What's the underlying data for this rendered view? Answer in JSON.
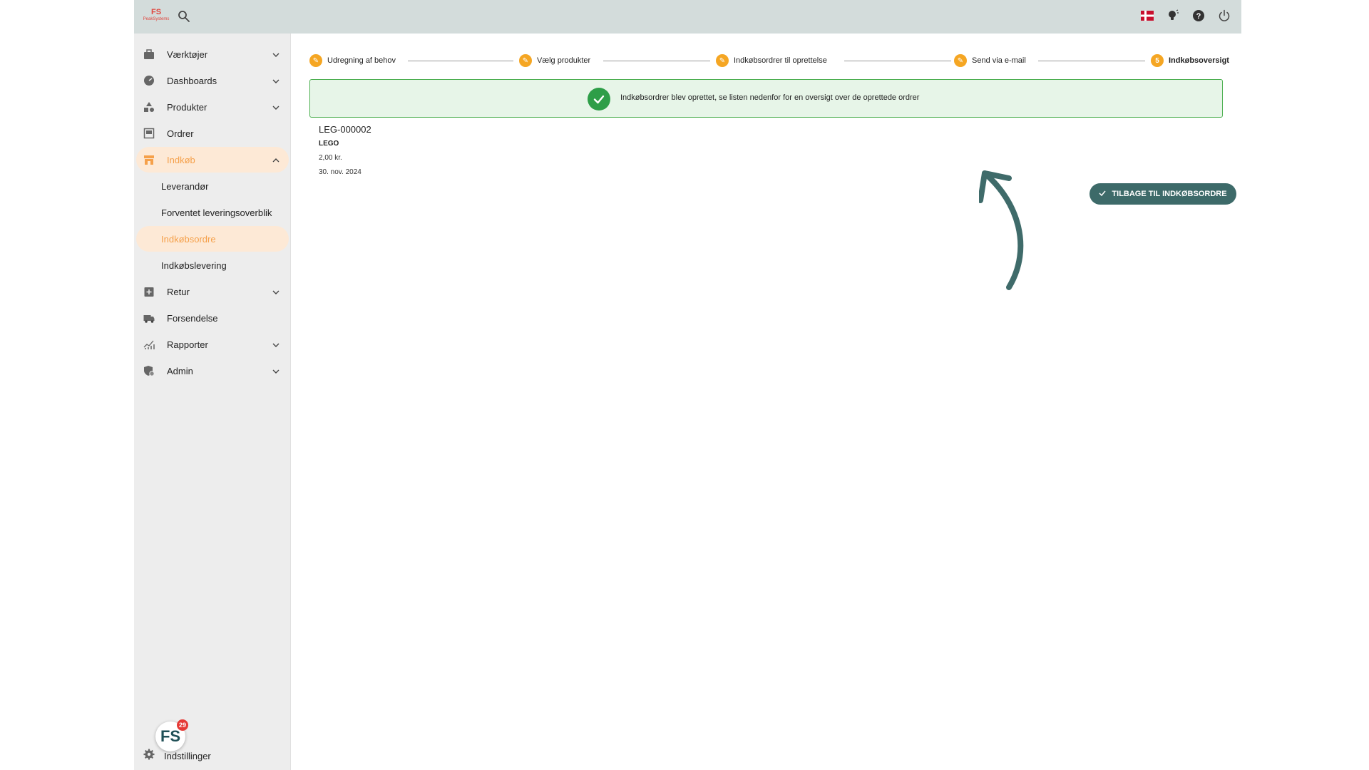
{
  "topbar": {
    "logo_mark": "FS",
    "logo_name": "PeakSystems",
    "icons": [
      "search-icon",
      "danish-flag-icon",
      "lightbulb-icon",
      "help-icon",
      "power-icon"
    ]
  },
  "sidebar": {
    "items": [
      {
        "label": "Værktøjer",
        "icon": "toolbox-icon"
      },
      {
        "label": "Dashboards",
        "icon": "gauge-icon"
      },
      {
        "label": "Produkter",
        "icon": "shapes-icon"
      },
      {
        "label": "Ordrer",
        "icon": "inbox-icon"
      },
      {
        "label": "Indkøb",
        "icon": "store-icon"
      },
      {
        "label": "Retur",
        "icon": "return-box-icon"
      },
      {
        "label": "Forsendelse",
        "icon": "truck-icon"
      },
      {
        "label": "Rapporter",
        "icon": "chart-icon"
      },
      {
        "label": "Admin",
        "icon": "admin-shield-icon"
      }
    ],
    "sub_items": [
      {
        "label": "Leverandør"
      },
      {
        "label": "Forventet leveringsoverblik"
      },
      {
        "label": "Indkøbsordre"
      },
      {
        "label": "Indkøbslevering"
      }
    ],
    "help_badge": "29",
    "settings_label": "Indstillinger"
  },
  "stepper": {
    "steps": [
      {
        "label": "Udregning af behov",
        "marker": "✎"
      },
      {
        "label": "Vælg produkter",
        "marker": "✎"
      },
      {
        "label": "Indkøbsordrer til oprettelse",
        "marker": "✎"
      },
      {
        "label": "Send via e-mail",
        "marker": "✎"
      },
      {
        "label": "Indkøbsoversigt",
        "marker": "5"
      }
    ]
  },
  "alert": {
    "text": "Indkøbsordrer blev oprettet, se listen nedenfor for en oversigt over de oprettede ordrer"
  },
  "order": {
    "id": "LEG-000002",
    "supplier": "LEGO",
    "amount": "2,00 kr.",
    "date": "30. nov. 2024"
  },
  "actions": {
    "back_label": "TILBAGE TIL INDKØBSORDRE"
  },
  "colors": {
    "accent": "#f5a623",
    "active_bg": "#fde9d6",
    "success": "#2e9e48",
    "button": "#3d6a69",
    "topbar": "#d3dcdb"
  }
}
